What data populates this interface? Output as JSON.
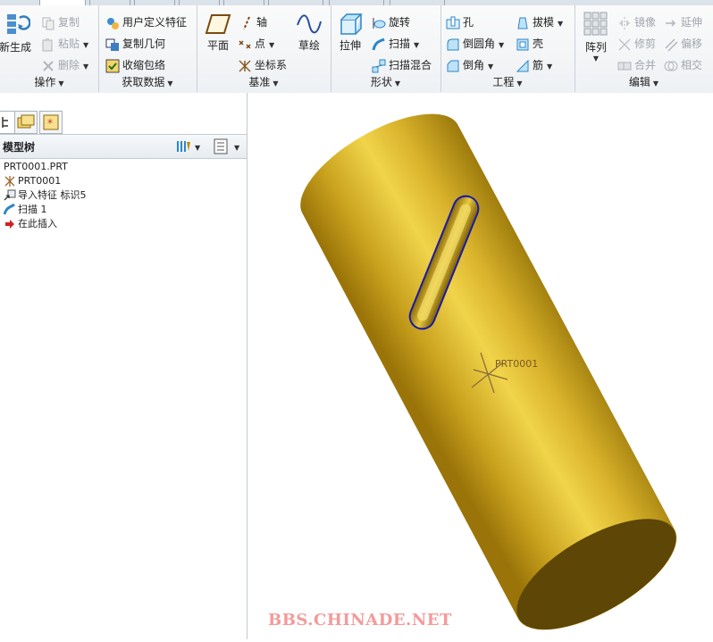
{
  "ribbon": {
    "groups": {
      "operations": {
        "label": "操作",
        "regenerate": "新生成",
        "copy": "复制",
        "paste": "粘贴",
        "delete": "删除"
      },
      "get_data": {
        "label": "获取数据",
        "user_defined_feature": "用户定义特征",
        "copy_geometry": "复制几何",
        "shrinkwrap": "收缩包络"
      },
      "datum": {
        "label": "基准",
        "plane": "平面",
        "axis": "轴",
        "point": "点",
        "coordinate_system": "坐标系",
        "sketch": "草绘"
      },
      "shapes": {
        "label": "形状",
        "extrude": "拉伸",
        "revolve": "旋转",
        "sweep": "扫描",
        "swept_blend": "扫描混合"
      },
      "engineering": {
        "label": "工程",
        "hole": "孔",
        "round": "倒圆角",
        "chamfer": "倒角",
        "draft": "拔模",
        "shell": "壳",
        "rib": "筋"
      },
      "editing": {
        "label": "编辑",
        "pattern": "阵列",
        "mirror": "镜像",
        "trim": "修剪",
        "merge": "合并",
        "extend": "延伸",
        "offset": "偏移",
        "intersect": "相交"
      }
    }
  },
  "left_panel": {
    "tree_title": "模型树",
    "tree_items": [
      {
        "icon": "part-file-icon",
        "label": "PRT0001.PRT"
      },
      {
        "icon": "coordinate-system-icon",
        "label": "PRT0001"
      },
      {
        "icon": "import-feature-icon",
        "label": "导入特征 标识5"
      },
      {
        "icon": "sweep-feature-icon",
        "label": "扫描 1"
      },
      {
        "icon": "insert-here-arrow-icon",
        "label": "在此插入"
      }
    ]
  },
  "viewport": {
    "csys_label": "PRT0001",
    "model_color": "#c9a21e",
    "edge_highlight_color": "#1a1aa8"
  },
  "watermark": "BBS.CHINADE.NET"
}
